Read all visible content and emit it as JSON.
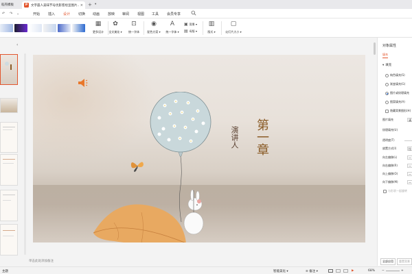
{
  "titlebar": {
    "home_label": "稻壳模板",
    "doc_title": "文字晨人美味节号优影客绘宣图片…",
    "ppt_badge": "P",
    "close": "×",
    "new_tab": "+",
    "tab_dropdown": "▾"
  },
  "menubar": {
    "undo": "↶",
    "redo": "↷",
    "more": "⌄",
    "items": [
      "开始",
      "插入",
      "设计",
      "切换",
      "动画",
      "放映",
      "审阅",
      "视图",
      "工具",
      "会员专享"
    ],
    "active_index": 2,
    "search_icon": "search-icon"
  },
  "ribbon": {
    "tools": [
      {
        "label": "更多设计",
        "icon": "▦"
      },
      {
        "label": "全文美化 ▾",
        "icon": "✿"
      },
      {
        "label": "统一字体",
        "icon": "⊡"
      },
      {
        "label": "配色方案 ▾",
        "icon": "◉"
      },
      {
        "label": "统一字体 ▾",
        "icon": "A"
      }
    ],
    "small_tools": [
      {
        "label": "背景 ▾",
        "icon": "▣"
      },
      {
        "label": "母版 ▾",
        "icon": "▤"
      },
      {
        "label": "版式 ▾",
        "icon": "▥"
      },
      {
        "label": "幻灯片大小 ▾",
        "icon": "▢"
      }
    ]
  },
  "slides": {
    "collapse_icon": "‹",
    "numbers": [
      "1",
      "2",
      "3",
      "4",
      "5",
      "6"
    ]
  },
  "slide": {
    "title": "第一章",
    "subtitle": "演讲人"
  },
  "notes_placeholder": "单击此处添加备注",
  "right_panel": {
    "title": "对象属性",
    "tab": "填充",
    "section": "填充",
    "options": [
      {
        "label": "纯色填充(S)",
        "checked": false
      },
      {
        "label": "渐变填充(G)",
        "checked": false
      },
      {
        "label": "图片或纹理填充",
        "checked": true
      },
      {
        "label": "图案填充(A)",
        "checked": false
      },
      {
        "label": "隐藏背景图形(H)",
        "checked": false,
        "type": "checkbox"
      }
    ],
    "rows": [
      {
        "label": "图片填充",
        "value": "请"
      },
      {
        "label": "纹理填充(U)",
        "value": ""
      },
      {
        "label": "透明度(T)",
        "value": ""
      },
      {
        "label": "放置方式(I)",
        "value": "拉"
      },
      {
        "label": "向左偏移(L)",
        "value": "—"
      },
      {
        "label": "向右偏移(R)",
        "value": "—"
      },
      {
        "label": "向上偏移(O)",
        "value": "—"
      },
      {
        "label": "向下偏移(M)",
        "value": "—"
      }
    ],
    "sync_option": "与形状一起旋转",
    "apply_all": "全部应用",
    "reset_bg": "重置背景"
  },
  "statusbar": {
    "left": "主题",
    "smart": "智能美化 ▾",
    "notes": "≡ 备注 ▾",
    "zoom": "68%",
    "zoom_out": "−",
    "zoom_in": "+"
  },
  "colors": {
    "accent": "#e2552d",
    "title_brown": "#8a5b26"
  }
}
